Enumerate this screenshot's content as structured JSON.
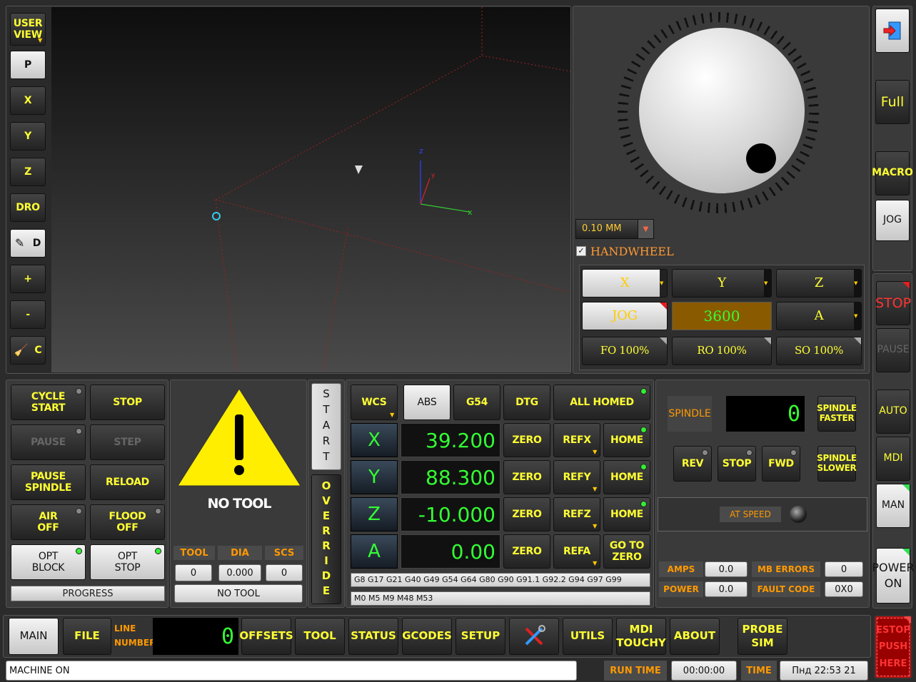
{
  "viewport": {
    "user_view": "USER\nVIEW",
    "buttons": [
      "P",
      "X",
      "Y",
      "Z",
      "DRO",
      "D",
      "+",
      "-",
      "C"
    ],
    "axis_labels": {
      "x": "x",
      "y": "y",
      "z": "z"
    }
  },
  "jog": {
    "increment": "0.10 MM",
    "handwheel_label": "HANDWHEEL",
    "axes": [
      "X",
      "Y",
      "Z"
    ],
    "jog_label": "JOG",
    "jog_rate": "3600",
    "axis_a": "A",
    "overrides": [
      "FO 100%",
      "RO 100%",
      "SO 100%"
    ]
  },
  "right_side": {
    "full": "Full",
    "macro": "MACRO",
    "jog": "JOG",
    "stop": "STOP",
    "pause": "PAUSE",
    "auto": "AUTO",
    "mdi": "MDI",
    "man": "MAN",
    "power": "POWER\nON",
    "estop": "ESTOP\nPUSH\nHERE"
  },
  "cycle": {
    "cycle_start": "CYCLE\nSTART",
    "stop": "STOP",
    "pause": "PAUSE",
    "step": "STEP",
    "pause_spindle": "PAUSE\nSPINDLE",
    "reload": "RELOAD",
    "air_off": "AIR\nOFF",
    "flood_off": "FLOOD\nOFF",
    "opt_block": "OPT\nBLOCK",
    "opt_stop": "OPT\nSTOP",
    "progress": "PROGRESS"
  },
  "tool": {
    "no_tool_caption": "NO TOOL",
    "headers": [
      "TOOL",
      "DIA",
      "SCS"
    ],
    "values": [
      "0",
      "0.000",
      "0"
    ],
    "tool_name": "NO TOOL"
  },
  "vertical": {
    "start": "START",
    "override": "OVERRIDE"
  },
  "dro": {
    "wcs": "WCS",
    "abs": "ABS",
    "g54": "G54",
    "dtg": "DTG",
    "all_homed": "ALL HOMED",
    "zero": "ZERO",
    "home": "HOME",
    "goto_zero": "GO TO\nZERO",
    "axes": [
      {
        "name": "X",
        "value": "39.200",
        "ref": "REFX"
      },
      {
        "name": "Y",
        "value": "88.300",
        "ref": "REFY"
      },
      {
        "name": "Z",
        "value": "-10.000",
        "ref": "REFZ"
      },
      {
        "name": "A",
        "value": "0.00",
        "ref": "REFA"
      }
    ],
    "gcodes": "G8 G17 G21 G40 G49 G54 G64 G80 G90 G91.1 G92.2 G94 G97 G99",
    "mcodes": "M0 M5 M9 M48 M53"
  },
  "spindle": {
    "label": "SPINDLE",
    "speed": "0",
    "faster": "SPINDLE\nFASTER",
    "slower": "SPINDLE\nSLOWER",
    "rev": "REV",
    "stop": "STOP",
    "fwd": "FWD",
    "at_speed": "AT SPEED",
    "amps_label": "AMPS",
    "amps": "0.0",
    "power_label": "POWER",
    "power": "0.0",
    "mb_errors_label": "MB ERRORS",
    "mb_errors": "0",
    "fault_code_label": "FAULT CODE",
    "fault_code": "0X0"
  },
  "tabs": {
    "main": "MAIN",
    "file": "FILE",
    "line_number_label": "LINE\nNUMBER",
    "line_number": "0",
    "offsets": "OFFSETS",
    "tool": "TOOL",
    "status": "STATUS",
    "gcodes": "GCODES",
    "setup": "SETUP",
    "utils": "UTILS",
    "mdi_touchy": "MDI\nTOUCHY",
    "about": "ABOUT",
    "probe_sim": "PROBE\nSIM"
  },
  "statusbar": {
    "message": "MACHINE ON",
    "run_time_label": "RUN TIME",
    "run_time": "00:00:00",
    "time_label": "TIME",
    "time": "Пнд 22:53 21"
  }
}
